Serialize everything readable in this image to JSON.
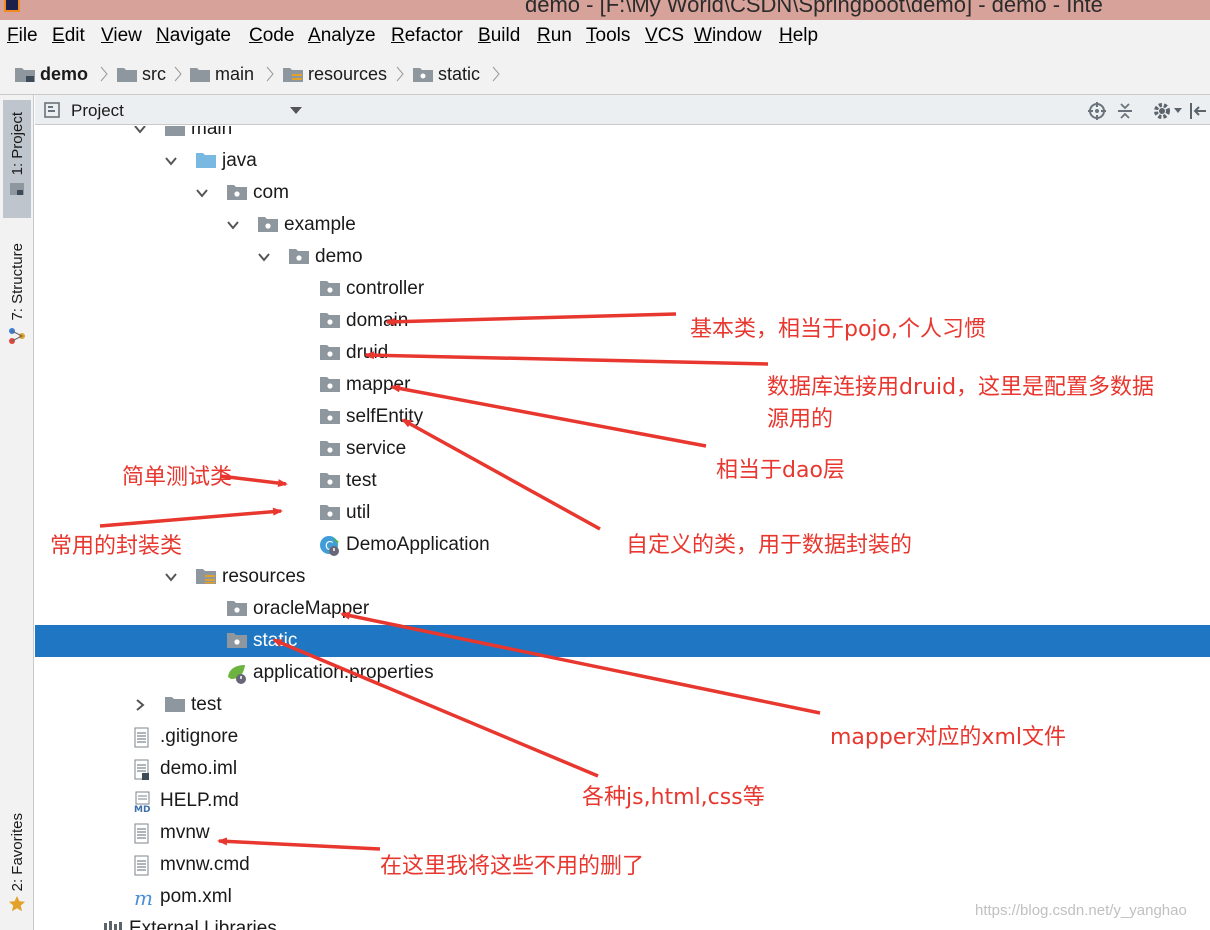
{
  "window": {
    "title": "demo - [F:\\My World\\CSDN\\Springboot\\demo] - demo - Inte"
  },
  "menu": [
    "File",
    "Edit",
    "View",
    "Navigate",
    "Code",
    "Analyze",
    "Refactor",
    "Build",
    "Run",
    "Tools",
    "VCS",
    "Window",
    "Help"
  ],
  "breadcrumb": [
    "demo",
    "src",
    "main",
    "resources",
    "static"
  ],
  "toolwindows": {
    "project": "1: Project",
    "structure": "7: Structure",
    "favorites": "2: Favorites"
  },
  "panel": {
    "title": "Project"
  },
  "tree": [
    {
      "label": "main",
      "kind": "folder-gray",
      "expanded": true
    },
    {
      "label": "java",
      "kind": "folder-blue",
      "expanded": true
    },
    {
      "label": "com",
      "kind": "package",
      "expanded": true
    },
    {
      "label": "example",
      "kind": "package",
      "expanded": true
    },
    {
      "label": "demo",
      "kind": "package",
      "expanded": true
    },
    {
      "label": "controller",
      "kind": "package"
    },
    {
      "label": "domain",
      "kind": "package"
    },
    {
      "label": "druid",
      "kind": "package"
    },
    {
      "label": "mapper",
      "kind": "package"
    },
    {
      "label": "selfEntity",
      "kind": "package"
    },
    {
      "label": "service",
      "kind": "package"
    },
    {
      "label": "test",
      "kind": "package"
    },
    {
      "label": "util",
      "kind": "package"
    },
    {
      "label": "DemoApplication",
      "kind": "spring-class"
    },
    {
      "label": "resources",
      "kind": "resources-folder",
      "expanded": true
    },
    {
      "label": "oracleMapper",
      "kind": "package"
    },
    {
      "label": "static",
      "kind": "package",
      "selected": true
    },
    {
      "label": "application.properties",
      "kind": "spring-config"
    },
    {
      "label": "test",
      "kind": "folder-gray",
      "expanded": false
    },
    {
      "label": ".gitignore",
      "kind": "text-file"
    },
    {
      "label": "demo.iml",
      "kind": "iml-file"
    },
    {
      "label": "HELP.md",
      "kind": "md-file"
    },
    {
      "label": "mvnw",
      "kind": "text-file"
    },
    {
      "label": "mvnw.cmd",
      "kind": "text-file"
    },
    {
      "label": "pom.xml",
      "kind": "maven-file"
    },
    {
      "label": "External Libraries",
      "kind": "libraries"
    }
  ],
  "annotations": {
    "domain": "基本类，相当于pojo,个人习惯",
    "druid_line1": "数据库连接用druid，这里是配置多数据",
    "druid_line2": "源用的",
    "mapper": "相当于dao层",
    "test": "简单测试类",
    "util": "常用的封装类",
    "selfEntity": "自定义的类，用于数据封装的",
    "oracleMapper": "mapper对应的xml文件",
    "static": "各种js,html,css等",
    "removed": "在这里我将这些不用的删了"
  },
  "colors": {
    "selection": "#1f77c3",
    "annotation": "#e8372f",
    "titlebar": "#d6a29a",
    "chrome": "#f2f2f2"
  },
  "watermark": "https://blog.csdn.net/y_yanghao"
}
